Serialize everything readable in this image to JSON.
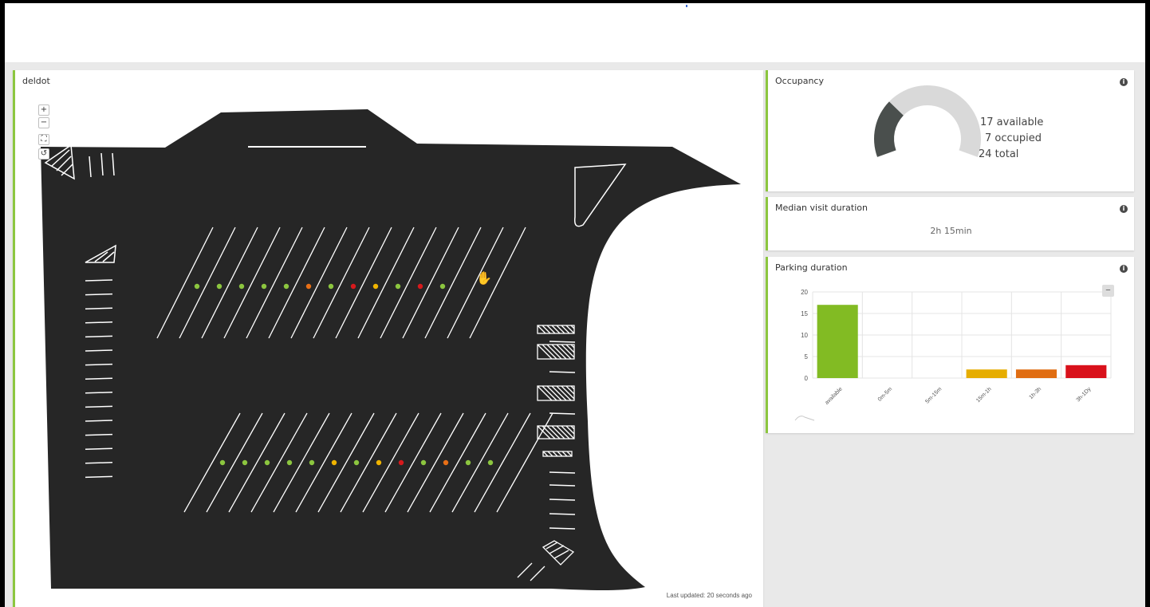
{
  "map": {
    "title": "deldot",
    "controls": [
      "+",
      "−",
      "⛶",
      "↺"
    ],
    "last_updated": "Last updated: 20 seconds ago",
    "spot_colors": {
      "green": "#8cc63f",
      "orange": "#e86f16",
      "red": "#d7191c",
      "yellow": "#f0b400"
    },
    "row1_spots": [
      "green",
      "green",
      "green",
      "green",
      "green",
      "orange",
      "green",
      "red",
      "yellow",
      "green",
      "red",
      "green"
    ],
    "row2_spots": [
      "green",
      "green",
      "green",
      "green",
      "green",
      "yellow",
      "green",
      "yellow",
      "red",
      "green",
      "orange",
      "green",
      "green"
    ]
  },
  "occupancy": {
    "title": "Occupancy",
    "available_text": "17 available",
    "occupied_text": "7 occupied",
    "total_text": "24 total",
    "available": 17,
    "occupied": 7,
    "total": 24,
    "colors": {
      "occupied": "#4a4f4d",
      "available": "#d9d9d9"
    }
  },
  "median": {
    "title": "Median visit duration",
    "value": "2h 15min"
  },
  "parking": {
    "title": "Parking duration",
    "zoom_label": "−"
  },
  "chart_data": {
    "type": "bar",
    "title": "Parking duration",
    "categories": [
      "available",
      "0m-5m",
      "5m-15m",
      "15m-1h",
      "1h-3h",
      "3h-1Dy"
    ],
    "values": [
      17,
      0,
      0,
      2,
      2,
      3
    ],
    "colors": [
      "#82bb23",
      "#82bb23",
      "#82bb23",
      "#e6ad00",
      "#e06d12",
      "#d9111b"
    ],
    "ylim": [
      0,
      20
    ],
    "yticks": [
      0,
      5,
      10,
      15,
      20
    ],
    "grid": true,
    "xlabel": "",
    "ylabel": ""
  }
}
